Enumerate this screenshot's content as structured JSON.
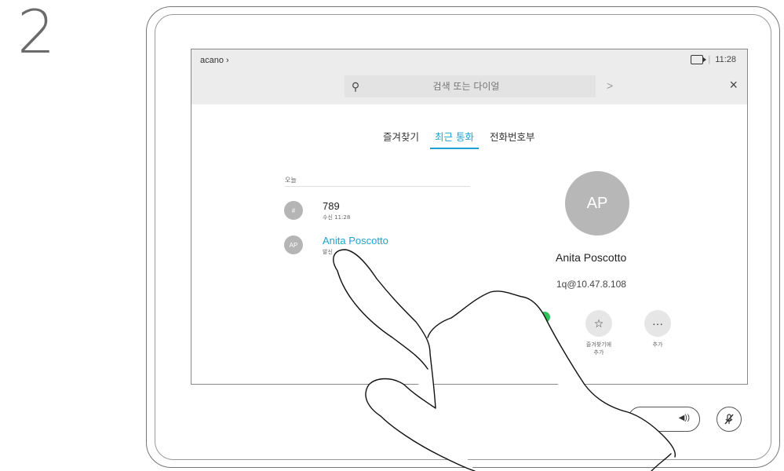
{
  "step": {
    "number": "2"
  },
  "topbar": {
    "brand": "acano",
    "brand_chevron": "›",
    "time": "11:28",
    "separator": "|"
  },
  "search": {
    "placeholder": "검색 또는 다이얼",
    "go_label": ">",
    "close_label": "×"
  },
  "tabs": [
    {
      "label": "즐겨찾기"
    },
    {
      "label": "최근 통화"
    },
    {
      "label": "전화번호부"
    }
  ],
  "list": {
    "section": "오늘",
    "items": [
      {
        "avatar": "#",
        "title": "789",
        "subtitle": "수신 11:28"
      },
      {
        "avatar": "AP",
        "title": "Anita Poscotto",
        "subtitle": "발신"
      }
    ]
  },
  "detail": {
    "initials": "AP",
    "name": "Anita Poscotto",
    "address": "1q@10.47.8.108",
    "actions": [
      {
        "icon": "☆",
        "label_line1": "즐겨찾기에",
        "label_line2": "추가"
      },
      {
        "icon": "···",
        "label_line1": "추가",
        "label_line2": ""
      }
    ]
  },
  "controls": {
    "volume_icon": "◀))",
    "mute_icon": "🎙"
  },
  "colors": {
    "accent": "#1ea3d0",
    "call_green": "#2fc35a",
    "avatar_gray": "#b5b5b5"
  }
}
